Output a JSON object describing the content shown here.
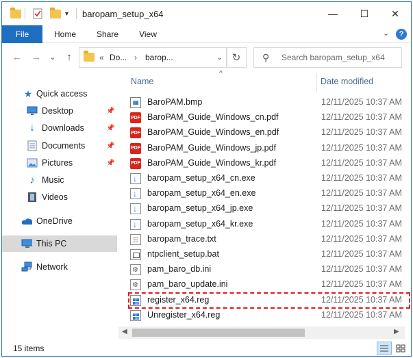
{
  "window": {
    "title": "baropam_setup_x64",
    "minimize": "—",
    "maximize": "☐",
    "close": "✕"
  },
  "ribbon": {
    "tabs": [
      "File",
      "Home",
      "Share",
      "View"
    ],
    "expand_glyph": "⌄",
    "help_glyph": "?"
  },
  "navbar": {
    "back": "←",
    "forward": "→",
    "recent": "⌄",
    "up": "↑",
    "address_segments": [
      "«",
      "Do...",
      "›",
      "barop...",
      "⌄"
    ],
    "refresh": "↻",
    "search_placeholder": "Search baropam_setup_x64",
    "search_icon": "⚲"
  },
  "sidebar": {
    "items": [
      {
        "label": "Quick access",
        "icon": "star-icon",
        "pinned": false
      },
      {
        "label": "Desktop",
        "icon": "desktop-icon",
        "pinned": true
      },
      {
        "label": "Downloads",
        "icon": "download-icon",
        "pinned": true
      },
      {
        "label": "Documents",
        "icon": "documents-icon",
        "pinned": true
      },
      {
        "label": "Pictures",
        "icon": "pictures-icon",
        "pinned": true
      },
      {
        "label": "Music",
        "icon": "music-icon",
        "pinned": false
      },
      {
        "label": "Videos",
        "icon": "videos-icon",
        "pinned": false
      },
      {
        "label": "OneDrive",
        "icon": "cloud-icon",
        "pinned": false
      },
      {
        "label": "This PC",
        "icon": "pc-icon",
        "pinned": false,
        "selected": true
      },
      {
        "label": "Network",
        "icon": "network-icon",
        "pinned": false
      }
    ],
    "pin_glyph": "📌"
  },
  "columns": {
    "name": "Name",
    "date_modified": "Date modified",
    "sort_glyph": "^"
  },
  "files": [
    {
      "name": "BaroPAM.bmp",
      "date": "12/11/2025 10:37 AM",
      "type": "bmp"
    },
    {
      "name": "BaroPAM_Guide_Windows_cn.pdf",
      "date": "12/11/2025 10:37 AM",
      "type": "pdf"
    },
    {
      "name": "BaroPAM_Guide_Windows_en.pdf",
      "date": "12/11/2025 10:37 AM",
      "type": "pdf"
    },
    {
      "name": "BaroPAM_Guide_Windows_jp.pdf",
      "date": "12/11/2025 10:37 AM",
      "type": "pdf"
    },
    {
      "name": "BaroPAM_Guide_Windows_kr.pdf",
      "date": "12/11/2025 10:37 AM",
      "type": "pdf"
    },
    {
      "name": "baropam_setup_x64_cn.exe",
      "date": "12/11/2025 10:37 AM",
      "type": "exe"
    },
    {
      "name": "baropam_setup_x64_en.exe",
      "date": "12/11/2025 10:37 AM",
      "type": "exe"
    },
    {
      "name": "baropam_setup_x64_jp.exe",
      "date": "12/11/2025 10:37 AM",
      "type": "exe"
    },
    {
      "name": "baropam_setup_x64_kr.exe",
      "date": "12/11/2025 10:37 AM",
      "type": "exe"
    },
    {
      "name": "baropam_trace.txt",
      "date": "12/11/2025 10:37 AM",
      "type": "txt"
    },
    {
      "name": "ntpclient_setup.bat",
      "date": "12/11/2025 10:37 AM",
      "type": "bat"
    },
    {
      "name": "pam_baro_db.ini",
      "date": "12/11/2025 10:37 AM",
      "type": "ini"
    },
    {
      "name": "pam_baro_update.ini",
      "date": "12/11/2025 10:37 AM",
      "type": "ini"
    },
    {
      "name": "register_x64.reg",
      "date": "12/11/2025 10:37 AM",
      "type": "reg",
      "highlighted": true
    },
    {
      "name": "Unregister_x64.reg",
      "date": "12/11/2025 10:37 AM",
      "type": "reg"
    }
  ],
  "statusbar": {
    "item_count": "15 items"
  },
  "colors": {
    "file_tab": "#1e6fc1",
    "highlight_border": "#e8141f",
    "selected_nav": "#d9d9d9",
    "column_header": "#4a6c8c"
  }
}
